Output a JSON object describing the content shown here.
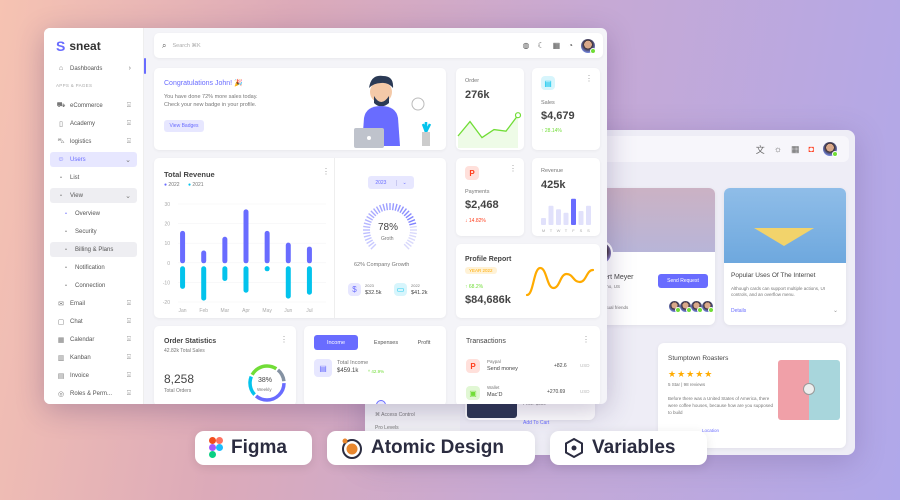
{
  "back_window": {
    "topbar_icons": [
      "translate-icon",
      "sun-icon",
      "grid-icon",
      "bell-icon"
    ],
    "profile_card": {
      "name": "bert Meyer",
      "subtitle": "Idaho, US",
      "button": "Send Request",
      "mutual": "Mutual friends"
    },
    "blog_card": {
      "title": "Popular Uses Of The Internet",
      "body": "Although cards can support multiple actions, UI controls, and an overflow menu.",
      "link": "Details"
    },
    "review_card": {
      "title": "Stumptown Roasters",
      "stars": 5,
      "rating": "5 Star | 98 reviews",
      "body": "Before there was a United States of America, there were coffee houses, because how are you supposed to build",
      "link": "Location"
    },
    "product_card": {
      "text1": "Announced",
      "text2": "Apple A13",
      "price_label": "Price: $999",
      "add_to_cart": "Add To Cart"
    },
    "side_menu": {
      "item1": "Access Control",
      "item2": "Pro Levels"
    }
  },
  "app": {
    "logo": "sneat"
  },
  "sidebar": {
    "section_label": "APPS & PAGES",
    "items": [
      {
        "label": "Dashboards",
        "icon": "home-icon",
        "trail": "chevron"
      },
      {
        "label": "eCommerce",
        "icon": "cart-icon",
        "trail": "lock"
      },
      {
        "label": "Academy",
        "icon": "book-icon",
        "trail": "lock"
      },
      {
        "label": "logistics",
        "icon": "truck-icon",
        "trail": "lock"
      },
      {
        "label": "Users",
        "icon": "user-icon",
        "trail": "chevron-down",
        "active": true
      },
      {
        "label": "List",
        "sub": true
      },
      {
        "label": "View",
        "sub": true,
        "trail": "chevron-down"
      },
      {
        "label": "Overview",
        "sub2": true,
        "active": true
      },
      {
        "label": "Security",
        "sub2": true
      },
      {
        "label": "Billing & Plans",
        "sub2": true
      },
      {
        "label": "Notification",
        "sub2": true
      },
      {
        "label": "Connection",
        "sub2": true
      },
      {
        "label": "Email",
        "icon": "mail-icon",
        "trail": "lock"
      },
      {
        "label": "Chat",
        "icon": "chat-icon",
        "trail": "lock"
      },
      {
        "label": "Calendar",
        "icon": "calendar-icon",
        "trail": "lock"
      },
      {
        "label": "Kanban",
        "icon": "kanban-icon",
        "trail": "lock"
      },
      {
        "label": "Invoice",
        "icon": "invoice-icon",
        "trail": "lock"
      },
      {
        "label": "Roles & Perm...",
        "icon": "shield-check-icon",
        "trail": "lock"
      }
    ]
  },
  "header": {
    "search_placeholder": "Search ⌘K",
    "icons": [
      "globe-icon",
      "moon-icon",
      "grid-icon",
      "bell-icon"
    ]
  },
  "welcome": {
    "title": "Congratulations John! 🎉",
    "line1": "You have done 72% more sales today.",
    "line2": "Check your new badge in your profile.",
    "button": "View Badges"
  },
  "order": {
    "label": "Order",
    "value": "276k"
  },
  "sales": {
    "label": "Sales",
    "value": "$4,679",
    "change": "↑ 28.14%"
  },
  "revenue_chart": {
    "title": "Total Revenue",
    "legend": [
      "2022",
      "2021"
    ]
  },
  "growth": {
    "year": "2023",
    "percent": "78%",
    "label": "Groth",
    "company": "62% Company Growth",
    "stat1_year": "2023",
    "stat1_value": "$32.5k",
    "stat2_year": "2022",
    "stat2_value": "$41.2k"
  },
  "payments": {
    "label": "Payments",
    "value": "$2,468",
    "change": "↓ 14.82%"
  },
  "revenue": {
    "label": "Revenue",
    "value": "425k",
    "days": [
      "M",
      "T",
      "W",
      "T",
      "F",
      "S",
      "S"
    ]
  },
  "profile_report": {
    "title": "Profile Report",
    "badge": "YEAR 2022",
    "change": "↑ 68.2%",
    "value": "$84,686k"
  },
  "order_stats": {
    "title": "Order Statistics",
    "subtitle": "42.82k Total Sales",
    "value": "8,258",
    "value_label": "Total Orders",
    "donut_pct": "38%",
    "donut_label": "Weekly"
  },
  "income": {
    "tabs": [
      "Income",
      "Expenses",
      "Profit"
    ],
    "label": "Total Income",
    "value": "$459.1k",
    "change": "^ 42.9%"
  },
  "transactions": {
    "title": "Transactions",
    "items": [
      {
        "source": "Paypal",
        "desc": "Send money",
        "amount": "+82.6",
        "currency": "USD"
      },
      {
        "source": "Wallet",
        "desc": "Mac'D",
        "amount": "+270.69",
        "currency": "USD"
      }
    ]
  },
  "chart_data": [
    {
      "type": "bar",
      "title": "Total Revenue",
      "categories": [
        "Jan",
        "Feb",
        "Mar",
        "Apr",
        "May",
        "Jun",
        "Jul"
      ],
      "series": [
        {
          "name": "2022",
          "values": [
            15,
            5,
            12,
            26,
            15,
            9,
            7
          ]
        },
        {
          "name": "2021",
          "values": [
            -12,
            -18,
            -8,
            -14,
            -3,
            -17,
            -15
          ]
        }
      ],
      "yticks": [
        30,
        20,
        10,
        0,
        -10,
        -20
      ],
      "ylim": [
        -20,
        30
      ],
      "colors": [
        "#696cff",
        "#03c3ec"
      ]
    },
    {
      "type": "line",
      "title": "Order",
      "values": [
        10,
        28,
        8,
        18,
        16,
        36
      ],
      "color": "#71dd37"
    },
    {
      "type": "bar",
      "title": "Revenue",
      "categories": [
        "M",
        "T",
        "W",
        "T",
        "F",
        "S",
        "S"
      ],
      "values": [
        20,
        55,
        45,
        35,
        75,
        40,
        55
      ],
      "highlight": 4
    },
    {
      "type": "line",
      "title": "Profile Report",
      "values": [
        5,
        32,
        12,
        26,
        18,
        30
      ],
      "color": "#ffab00"
    },
    {
      "type": "pie",
      "title": "Order Statistics",
      "values": [
        38,
        20,
        28,
        14
      ],
      "colors": [
        "#696cff",
        "#03c3ec",
        "#71dd37",
        "#8592a3"
      ]
    }
  ],
  "badges": [
    {
      "label": "Figma",
      "icon": "figma-icon"
    },
    {
      "label": "Atomic Design",
      "icon": "atom-icon"
    },
    {
      "label": "Variables",
      "icon": "hexagon-icon"
    }
  ],
  "colors": {
    "primary": "#696cff",
    "info": "#03c3ec",
    "success": "#71dd37",
    "danger": "#ff3e1d",
    "warning": "#ffab00"
  }
}
